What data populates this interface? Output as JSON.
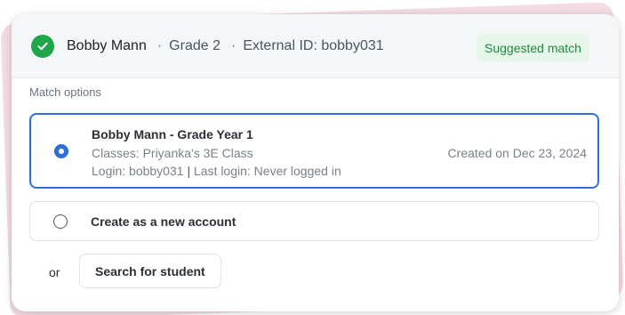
{
  "header": {
    "name": "Bobby Mann",
    "grade": "Grade 2",
    "external_id": "External ID: bobby031",
    "badge": "Suggested match",
    "separator": "·"
  },
  "section_label": "Match options",
  "options": [
    {
      "title": "Bobby Mann - Grade Year 1",
      "classes": "Classes: Priyanka's 3E Class",
      "login": "Login: bobby031",
      "last_login": "Last login: Never logged in",
      "created": "Created on Dec 23, 2024",
      "selected": true
    },
    {
      "title": "Create as a new account",
      "selected": false
    }
  ],
  "or_label": "or",
  "search_button": "Search for student",
  "colors": {
    "accent": "#2f6fd8",
    "success": "#1fa64a",
    "badge_bg": "#e7f6ea",
    "badge_text": "#1f8a3d"
  }
}
